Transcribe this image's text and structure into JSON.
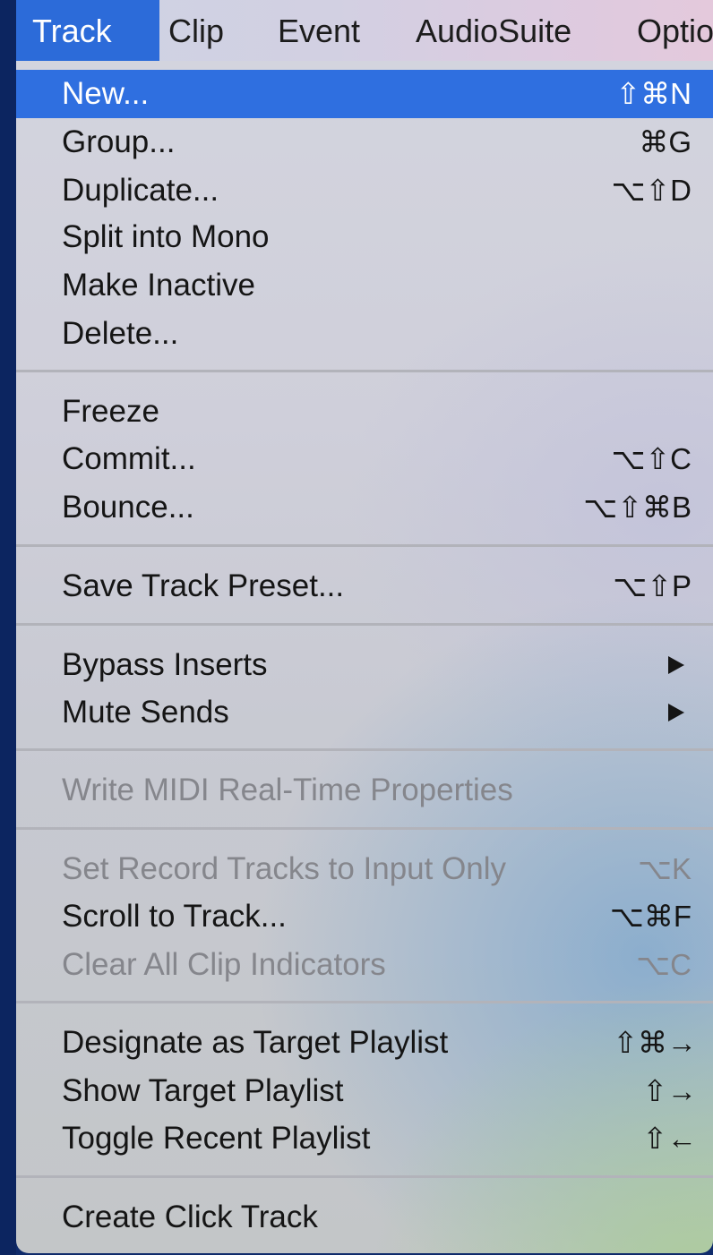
{
  "menubar": {
    "items": [
      "Track",
      "Clip",
      "Event",
      "AudioSuite",
      "Optio"
    ],
    "active": "Track"
  },
  "menu": {
    "items": [
      {
        "label": "New...",
        "shortcut": "⇧⌘N",
        "state": "highlighted"
      },
      {
        "label": "Group...",
        "shortcut": "⌘G"
      },
      {
        "label": "Duplicate...",
        "shortcut": "⌥⇧D"
      },
      {
        "label": "Split into Mono",
        "shortcut": ""
      },
      {
        "label": "Make Inactive",
        "shortcut": ""
      },
      {
        "label": "Delete...",
        "shortcut": ""
      },
      {
        "label": "Freeze",
        "shortcut": ""
      },
      {
        "label": "Commit...",
        "shortcut": "⌥⇧C"
      },
      {
        "label": "Bounce...",
        "shortcut": "⌥⇧⌘B"
      },
      {
        "label": "Save Track Preset...",
        "shortcut": "⌥⇧P"
      },
      {
        "label": "Bypass Inserts",
        "shortcut": "",
        "submenu": true
      },
      {
        "label": "Mute Sends",
        "shortcut": "",
        "submenu": true
      },
      {
        "label": "Write MIDI Real-Time Properties",
        "shortcut": "",
        "state": "disabled"
      },
      {
        "label": "Set Record Tracks to Input Only",
        "shortcut": "⌥K",
        "state": "disabled"
      },
      {
        "label": "Scroll to Track...",
        "shortcut": "⌥⌘F"
      },
      {
        "label": "Clear All Clip Indicators",
        "shortcut": "⌥C",
        "state": "disabled"
      },
      {
        "label": "Designate as Target Playlist",
        "shortcut": "⇧⌘→"
      },
      {
        "label": "Show Target Playlist",
        "shortcut": "⇧→"
      },
      {
        "label": "Toggle Recent Playlist",
        "shortcut": "⇧←"
      },
      {
        "label": "Create Click Track",
        "shortcut": ""
      }
    ]
  },
  "colors": {
    "highlight": "#2f6fe0",
    "disabled_text": "#85868c",
    "desktop": "#0f2b6b"
  },
  "icons": {
    "submenu": "submenu-arrow-icon"
  }
}
